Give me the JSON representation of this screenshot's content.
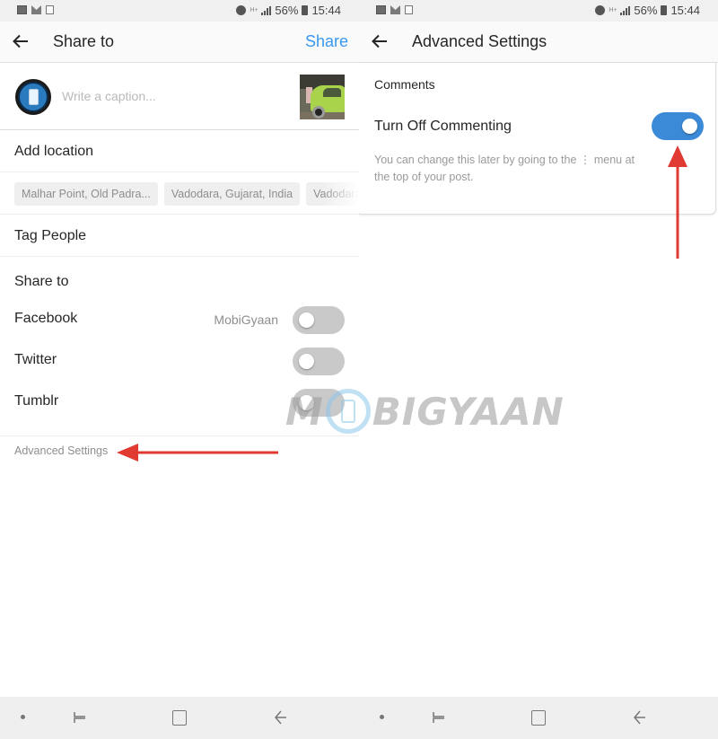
{
  "status_bar": {
    "battery": "56%",
    "time": "15:44",
    "network": "H+",
    "icons_left": [
      "gallery-icon",
      "mail-icon",
      "clipboard-check-icon"
    ],
    "icons_right": [
      "alarm-icon",
      "network-type-icon",
      "signal-icon",
      "battery-icon"
    ]
  },
  "left_screen": {
    "header": {
      "title": "Share to",
      "action": "Share",
      "accent_color": "#3897f0"
    },
    "caption": {
      "placeholder": "Write a caption...",
      "value": ""
    },
    "add_location": "Add location",
    "location_suggestions": [
      "Malhar Point, Old Padra...",
      "Vadodara, Gujarat, India",
      "Vadodara"
    ],
    "tag_people": "Tag People",
    "share_to_title": "Share to",
    "share_targets": [
      {
        "name": "Facebook",
        "account": "MobiGyaan",
        "enabled": false
      },
      {
        "name": "Twitter",
        "account": "",
        "enabled": false
      },
      {
        "name": "Tumblr",
        "account": "",
        "enabled": false
      }
    ],
    "advanced_settings": "Advanced Settings"
  },
  "right_screen": {
    "header": {
      "title": "Advanced Settings"
    },
    "section_title": "Comments",
    "option_label": "Turn Off Commenting",
    "option_enabled": true,
    "option_description": "You can change this later by going to the ⋮ menu at the top of your post.",
    "toggle_color": "#3b8ad8"
  },
  "watermark": {
    "prefix": "M",
    "suffix": "BIGYAAN"
  },
  "annotation_color": "#e03a33",
  "nav_bar": [
    "nav-dot",
    "recent-apps",
    "home",
    "back"
  ]
}
